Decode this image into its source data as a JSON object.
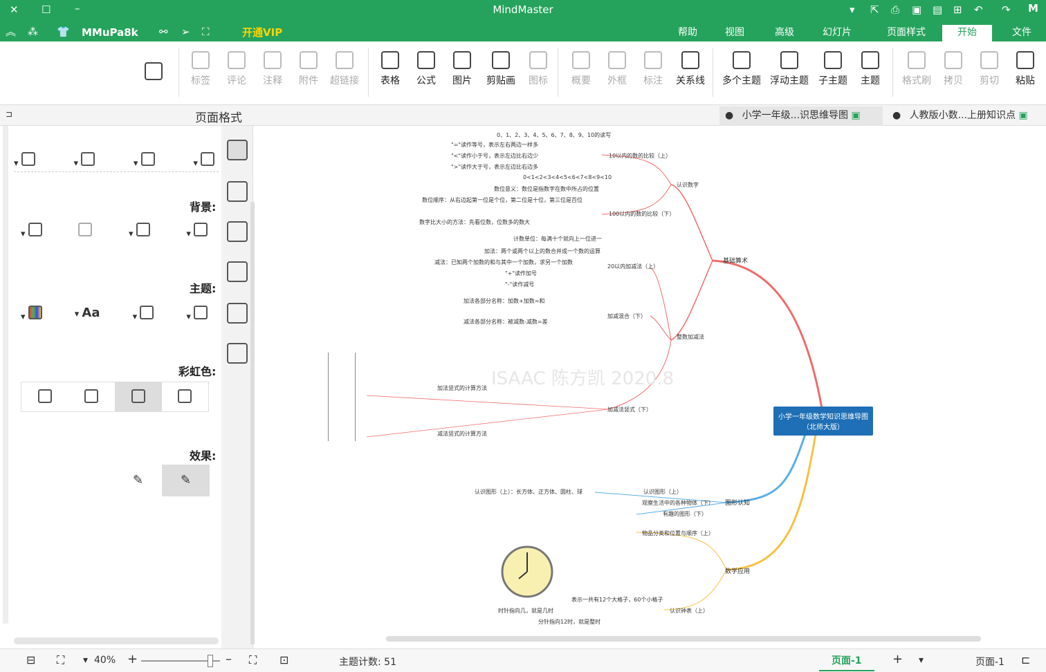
{
  "app": {
    "title": "MindMaster"
  },
  "quick": {
    "vip": "开通VIP",
    "user": "MMuPa8k"
  },
  "menu_tabs": [
    "文件",
    "开始",
    "页面样式",
    "幻灯片",
    "高级",
    "视图",
    "帮助"
  ],
  "active_menu": "开始",
  "ribbon": [
    "粘贴",
    "剪切",
    "拷贝",
    "格式刷",
    "主题",
    "子主题",
    "浮动主题",
    "多个主题",
    "关系线",
    "标注",
    "外框",
    "概要",
    "图标",
    "剪贴画",
    "图片",
    "公式",
    "表格",
    "超链接",
    "附件",
    "注释",
    "评论",
    "标签"
  ],
  "ribbon_disabled": [
    "剪切",
    "拷贝",
    "格式刷",
    "标注",
    "外框",
    "概要",
    "图标",
    "超链接",
    "附件",
    "注释",
    "评论",
    "标签"
  ],
  "doc_tabs": [
    "人教版小数...上册知识点",
    "小学一年级...识思维导图"
  ],
  "panel": {
    "title": "页面格式",
    "background": "背景:",
    "theme": "主题:",
    "rainbow": "彩虹色:",
    "effect": "效果:"
  },
  "map": {
    "root": "小学一年级数学知识思维导图（北师大版）",
    "watermark": "ISAAC 陈方凯 2020.8",
    "branches": [
      "基础算术",
      "图形认知",
      "数学应用"
    ],
    "sub": [
      "认识数字",
      "10以内的数的比较（上）",
      "100以内的数的比较（下）",
      "整数加减法",
      "20以内加减法（上）",
      "加减混合（下）",
      "加减法竖式（下）",
      "认识图形（上）",
      "观察生活中的各种物体（下）",
      "有趣的图形（下）",
      "物品分类和位置与顺序（上）",
      "认识钟表（上）"
    ],
    "leaves": [
      "0、1、2、3、4、5、6、7、8、9、10的读写",
      "\"=\"读作等号，表示左右两边一样多",
      "\"<\"读作小于号，表示左边比右边少",
      "\">\"读作大于号，表示左边比右边多",
      "0<1<2<3<4<5<6<7<8<9<10",
      "数位意义：数位是指数字在数中所占的位置",
      "数位顺序：从右边起第一位是个位，第二位是十位，第三位是百位",
      "数字比大小的方法：先看位数，位数多的数大",
      "计数单位：每满十个就向上一位进一",
      "加法：两个或两个以上的数合并成一个数的运算",
      "减法：已知两个加数的和与其中一个加数，求另一个加数",
      "\"+\"读作加号",
      "\"-\"读作减号",
      "加法各部分名称：加数+加数=和",
      "减法各部分名称：被减数-减数=差",
      "加法竖式的计算方法",
      "减法竖式的计算方法",
      "认识图形（上）：长方体、正方体、圆柱、球",
      "表示一共有12个大格子，60个小格子",
      "时针指向几，就是几时",
      "分针指向12时，就是整时"
    ]
  },
  "status": {
    "topics": "主题计数: 51",
    "zoom": "40%",
    "page": "页面-1",
    "page_tab": "页面-1"
  }
}
